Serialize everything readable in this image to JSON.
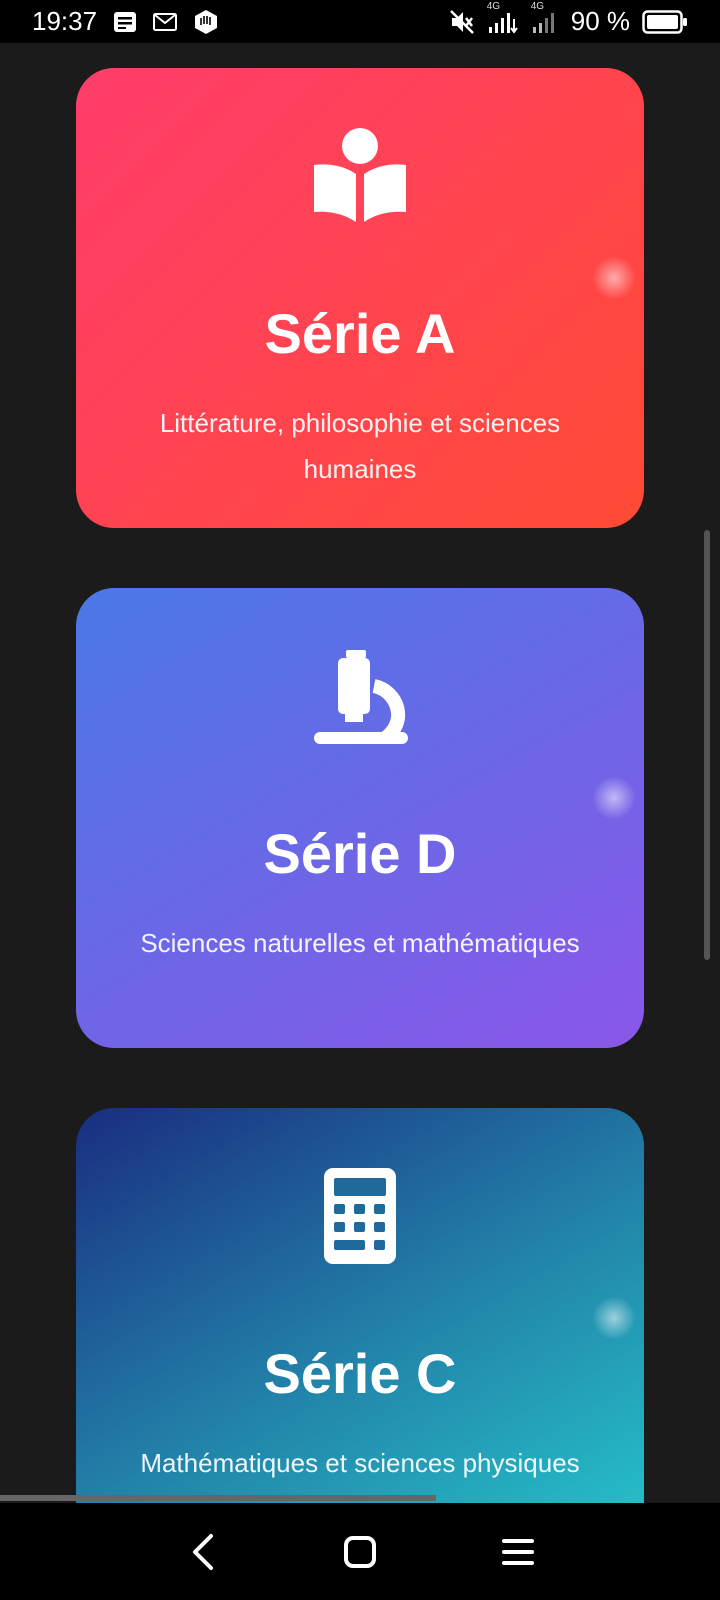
{
  "status_bar": {
    "time": "19:37",
    "network_1": "4G",
    "network_2": "4G",
    "battery": "90 %",
    "icons": [
      "notes-icon",
      "mail-icon",
      "hexagon-app-icon",
      "mute-icon",
      "signal-icon",
      "signal-weak-icon",
      "battery-icon"
    ]
  },
  "cards": [
    {
      "title": "Série A",
      "description": "Littérature, philosophie et sciences humaines",
      "icon": "reading-book-icon",
      "colors": [
        "#ff3d6b",
        "#ff4a35"
      ]
    },
    {
      "title": "Série D",
      "description": "Sciences naturelles et mathématiques",
      "icon": "microscope-icon",
      "colors": [
        "#4a78e6",
        "#8b57e8"
      ]
    },
    {
      "title": "Série C",
      "description": "Mathématiques et sciences physiques",
      "icon": "calculator-icon",
      "colors": [
        "#1a2d80",
        "#26c8cc"
      ]
    }
  ],
  "nav_bar": {
    "icons": [
      "back-icon",
      "home-icon",
      "menu-icon"
    ]
  }
}
